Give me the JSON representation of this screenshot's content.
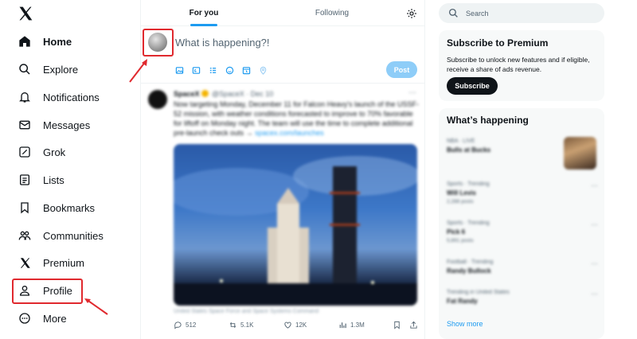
{
  "sidebar": {
    "items": [
      {
        "label": "Home",
        "icon": "home-icon"
      },
      {
        "label": "Explore",
        "icon": "search-icon"
      },
      {
        "label": "Notifications",
        "icon": "bell-icon"
      },
      {
        "label": "Messages",
        "icon": "envelope-icon"
      },
      {
        "label": "Grok",
        "icon": "grok-icon"
      },
      {
        "label": "Lists",
        "icon": "list-icon"
      },
      {
        "label": "Bookmarks",
        "icon": "bookmark-icon"
      },
      {
        "label": "Communities",
        "icon": "people-icon"
      },
      {
        "label": "Premium",
        "icon": "x-logo-icon"
      },
      {
        "label": "Profile",
        "icon": "person-icon"
      },
      {
        "label": "More",
        "icon": "more-circle-icon"
      }
    ]
  },
  "timeline": {
    "tabs": [
      {
        "label": "For you"
      },
      {
        "label": "Following"
      }
    ],
    "compose": {
      "placeholder": "What is happening?!",
      "post_label": "Post"
    },
    "tweet": {
      "name": "SpaceX",
      "handle": "@SpaceX",
      "date": "Dec 10",
      "text": "Now targeting Monday, December 11 for Falcon Heavy's launch of the USSF-52 mission, with weather conditions forecasted to improve to 70% favorable for liftoff on Monday night. The team will use the time to complete additional pre-launch check outs →",
      "link": "spacex.com/launches",
      "caption": "United States Space Force and Space Systems Command",
      "replies": "512",
      "reposts": "5.1K",
      "likes": "12K",
      "views": "1.3M"
    }
  },
  "right": {
    "search": {
      "placeholder": "Search"
    },
    "premium": {
      "title": "Subscribe to Premium",
      "text": "Subscribe to unlock new features and if eligible, receive a share of ads revenue.",
      "button": "Subscribe"
    },
    "happening": {
      "title": "What’s happening",
      "trends": [
        {
          "category": "NBA · LIVE",
          "title": "Bulls at Bucks",
          "posts": ""
        },
        {
          "category": "Sports · Trending",
          "title": "Will Levis",
          "posts": "2,288 posts"
        },
        {
          "category": "Sports · Trending",
          "title": "Pick 6",
          "posts": "5,891 posts"
        },
        {
          "category": "Football · Trending",
          "title": "Randy Bullock",
          "posts": ""
        },
        {
          "category": "Trending in United States",
          "title": "Fat Randy",
          "posts": ""
        }
      ],
      "show_more": "Show more"
    }
  },
  "colors": {
    "accent": "#1d9bf0",
    "highlight": "#e0292e",
    "post_button": "#8ecdf8"
  }
}
